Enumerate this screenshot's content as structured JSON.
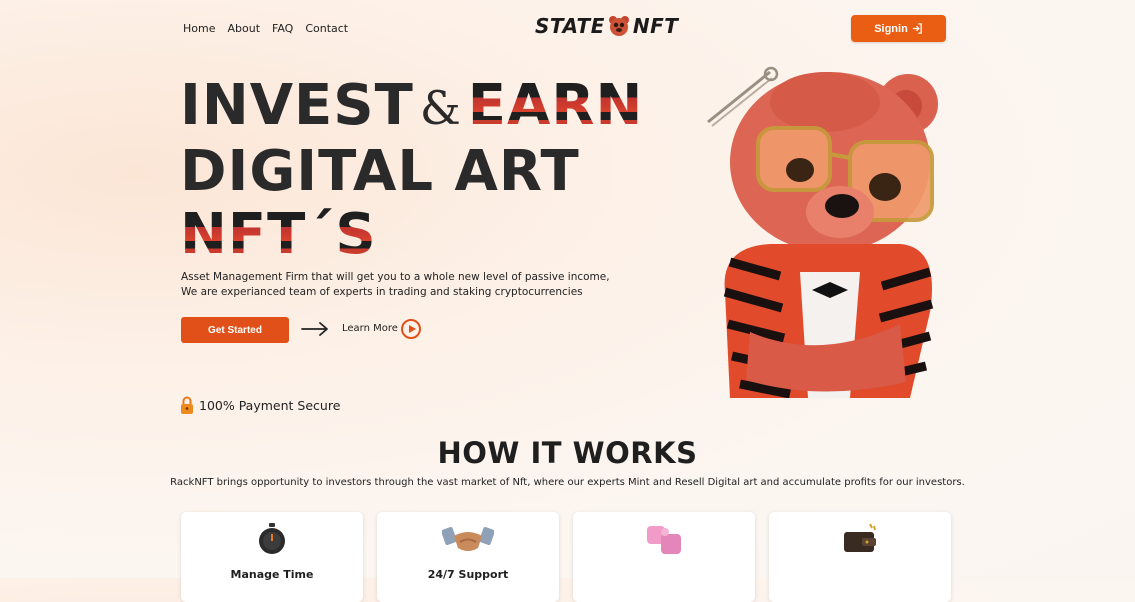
{
  "nav": {
    "items": [
      "Home",
      "About",
      "FAQ",
      "Contact"
    ]
  },
  "logo": {
    "left": "STATE",
    "right": "NFT"
  },
  "signin": {
    "label": "Signin",
    "icon": "login-icon"
  },
  "hero": {
    "line1_a": "INVEST",
    "amp": "&",
    "line1_b": "EARN",
    "line2": "DIGITAL ART",
    "line3": "NFT´S",
    "subtitle_1": "Asset Management Firm that will get you to a whole new level of passive income,",
    "subtitle_2": "We are experianced team of experts in trading and staking cryptocurrencies",
    "cta": "Get Started",
    "learn_more": "Learn More",
    "secure": "100% Payment Secure"
  },
  "how": {
    "title": "HOW IT WORKS",
    "subtitle": "RackNFT brings opportunity to investors through the vast market of Nft, where our experts Mint and Resell Digital art and accumulate profits for our investors.",
    "cards": [
      {
        "title": "Manage Time",
        "icon": "stopwatch-icon"
      },
      {
        "title": "24/7 Support",
        "icon": "handshake-icon"
      },
      {
        "title": "",
        "icon": "puzzle-icon"
      },
      {
        "title": "",
        "icon": "wallet-icon"
      }
    ]
  },
  "colors": {
    "accent": "#e95e12",
    "dark": "#1f1f1f",
    "stripe_red": "#c93b2d"
  }
}
